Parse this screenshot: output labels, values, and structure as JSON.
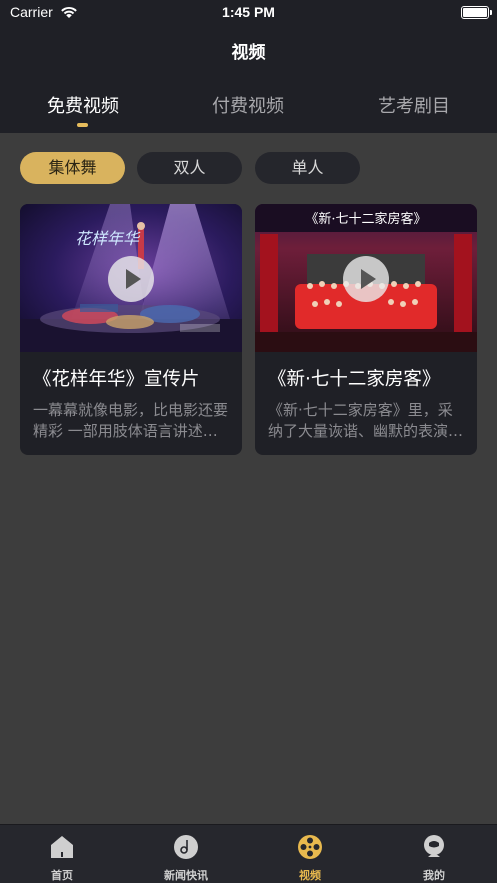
{
  "status_bar": {
    "carrier": "Carrier",
    "time": "1:45 PM"
  },
  "nav": {
    "title": "视频"
  },
  "top_tabs": [
    {
      "label": "免费视频",
      "active": true
    },
    {
      "label": "付费视频",
      "active": false
    },
    {
      "label": "艺考剧目",
      "active": false
    }
  ],
  "filter_chips": [
    {
      "label": "集体舞",
      "active": true
    },
    {
      "label": "双人",
      "active": false
    },
    {
      "label": "单人",
      "active": false
    }
  ],
  "videos": [
    {
      "title": "《花样年华》宣传片",
      "description": "一幕幕就像电影，比电影还要精彩  一部用肢体语言讲述的电影"
    },
    {
      "title": "《新·七十二家房客》",
      "description": "《新·七十二家房客》里，采纳了大量诙谐、幽默的表演元素"
    }
  ],
  "poster_text": {
    "huayang": "花样年华",
    "qishier": "《新·七十二家房客》"
  },
  "bottom_tabs": [
    {
      "label": "首页",
      "icon": "home-icon",
      "active": false
    },
    {
      "label": "新闻快讯",
      "icon": "news-icon",
      "active": false
    },
    {
      "label": "视频",
      "icon": "film-reel-icon",
      "active": true
    },
    {
      "label": "我的",
      "icon": "profile-icon",
      "active": false
    }
  ],
  "colors": {
    "accent": "#e6bc5c",
    "chip_active": "#d9b35e",
    "panel": "#1f2026",
    "background": "#3d3d3d"
  }
}
